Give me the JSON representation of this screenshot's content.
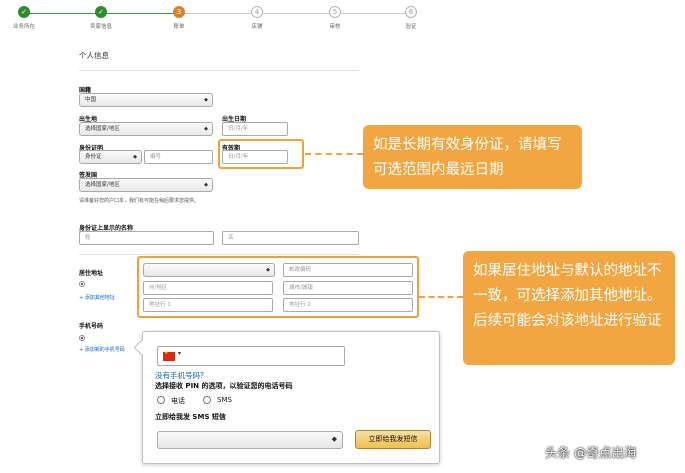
{
  "stepper": {
    "steps": [
      {
        "num": "✓",
        "label": "业务所在",
        "state": "done"
      },
      {
        "num": "✓",
        "label": "卖家信息",
        "state": "done"
      },
      {
        "num": "3",
        "label": "账单",
        "state": "current"
      },
      {
        "num": "4",
        "label": "店铺",
        "state": "todo"
      },
      {
        "num": "5",
        "label": "审核",
        "state": "todo"
      },
      {
        "num": "6",
        "label": "验证",
        "state": "todo"
      }
    ]
  },
  "form": {
    "section_title": "个人信息",
    "nationality": {
      "label": "国籍",
      "value": "中国"
    },
    "birthplace": {
      "label": "出生地",
      "value": "选择国家/地区"
    },
    "birthdate": {
      "label": "出生日期",
      "placeholder": "日/月/年"
    },
    "id_proof": {
      "label": "身份证明",
      "type_value": "身份证",
      "number_placeholder": "编号"
    },
    "validity": {
      "label": "有效期",
      "placeholder": "日/月/年"
    },
    "issuing_country": {
      "label": "签发国",
      "value": "选择国家/地区"
    },
    "hukou_note": "请准备好您的户口本，我们有可能在稍后要求您提供。",
    "id_name": {
      "label": "身份证上显示的名称",
      "surname_placeholder": "姓",
      "given_placeholder": "名"
    },
    "address": {
      "label": "居住地址",
      "country_value": "",
      "postcode_placeholder": "邮政编码",
      "state_placeholder": "州/地区",
      "city_placeholder": "城市/城镇",
      "line1_placeholder": "地址行 1",
      "line2_placeholder": "地址行 2",
      "add_link": "+ 添加其他地址"
    },
    "phone": {
      "label": "手机号码",
      "add_link": "+ 添加新的手机号码"
    }
  },
  "popup": {
    "no_phone_link": "没有手机号码?",
    "pin_option_text": "选择接收 PIN 的选项，以验证您的电话号码",
    "option_call": "电话",
    "option_sms": "SMS",
    "send_now_text": "立即给我发 SMS 短信",
    "language_value": "",
    "send_button": "立即给我发短信"
  },
  "callouts": {
    "validity_tip": "如是长期有效身份证，请填写可选范围内最远日期",
    "address_tip": "如果居住地址与默认的地址不一致，可选择添加其他地址。后续可能会对该地址进行验证"
  },
  "watermark": {
    "text": "头条 @奇点出海"
  },
  "colors": {
    "accent_orange": "#f2a641",
    "step_done": "#2e8b2e",
    "step_current": "#d9822b",
    "link_blue": "#0a66b7"
  }
}
